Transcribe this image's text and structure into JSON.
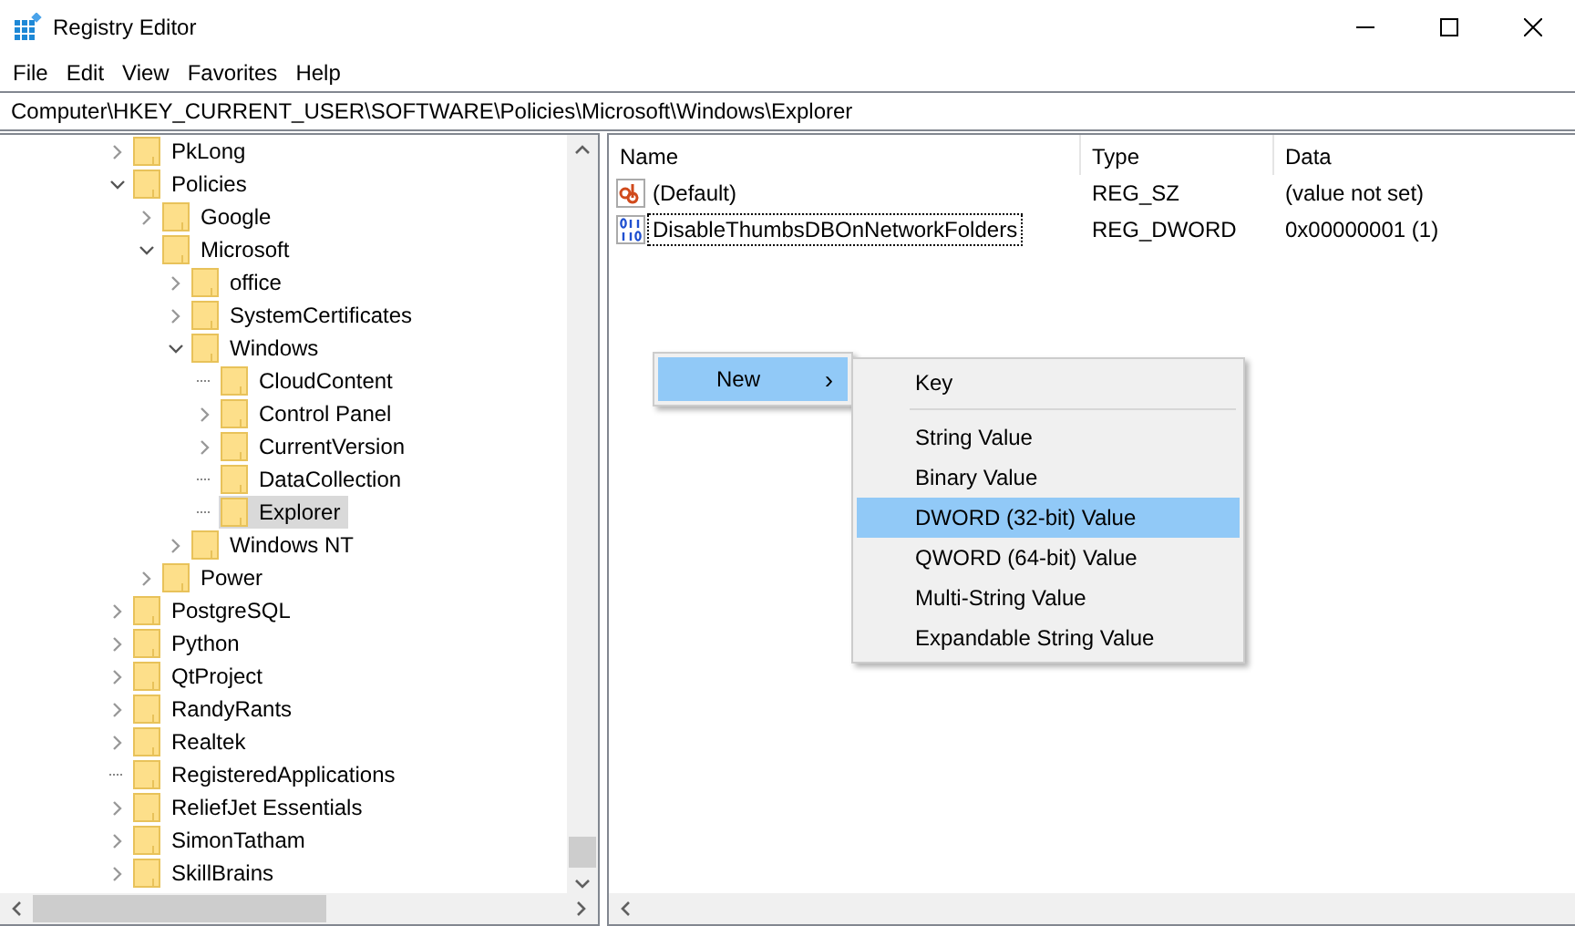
{
  "window": {
    "title": "Registry Editor"
  },
  "menu": [
    "File",
    "Edit",
    "View",
    "Favorites",
    "Help"
  ],
  "address": "Computer\\HKEY_CURRENT_USER\\SOFTWARE\\Policies\\Microsoft\\Windows\\Explorer",
  "tree": [
    {
      "label": "PkLong",
      "kind": "branch",
      "expanded": false,
      "selected": false
    },
    {
      "label": "Policies",
      "kind": "branch",
      "expanded": true,
      "selected": false,
      "children": [
        {
          "label": "Google",
          "kind": "branch",
          "expanded": false,
          "selected": false
        },
        {
          "label": "Microsoft",
          "kind": "branch",
          "expanded": true,
          "selected": false,
          "children": [
            {
              "label": "office",
              "kind": "branch",
              "expanded": false,
              "selected": false
            },
            {
              "label": "SystemCertificates",
              "kind": "branch",
              "expanded": false,
              "selected": false
            },
            {
              "label": "Windows",
              "kind": "branch",
              "expanded": true,
              "selected": false,
              "children": [
                {
                  "label": "CloudContent",
                  "kind": "leaf",
                  "selected": false
                },
                {
                  "label": "Control Panel",
                  "kind": "branch",
                  "expanded": false,
                  "selected": false
                },
                {
                  "label": "CurrentVersion",
                  "kind": "branch",
                  "expanded": false,
                  "selected": false
                },
                {
                  "label": "DataCollection",
                  "kind": "leaf",
                  "selected": false
                },
                {
                  "label": "Explorer",
                  "kind": "leaf",
                  "selected": true
                }
              ]
            },
            {
              "label": "Windows NT",
              "kind": "branch",
              "expanded": false,
              "selected": false
            }
          ]
        },
        {
          "label": "Power",
          "kind": "branch",
          "expanded": false,
          "selected": false
        }
      ]
    },
    {
      "label": "PostgreSQL",
      "kind": "branch",
      "expanded": false,
      "selected": false
    },
    {
      "label": "Python",
      "kind": "branch",
      "expanded": false,
      "selected": false
    },
    {
      "label": "QtProject",
      "kind": "branch",
      "expanded": false,
      "selected": false
    },
    {
      "label": "RandyRants",
      "kind": "branch",
      "expanded": false,
      "selected": false
    },
    {
      "label": "Realtek",
      "kind": "branch",
      "expanded": false,
      "selected": false
    },
    {
      "label": "RegisteredApplications",
      "kind": "leaf",
      "selected": false
    },
    {
      "label": "ReliefJet Essentials",
      "kind": "branch",
      "expanded": false,
      "selected": false
    },
    {
      "label": "SimonTatham",
      "kind": "branch",
      "expanded": false,
      "selected": false
    },
    {
      "label": "SkillBrains",
      "kind": "branch",
      "expanded": false,
      "selected": false
    }
  ],
  "values": {
    "columns": [
      "Name",
      "Type",
      "Data"
    ],
    "rows": [
      {
        "kind": "string",
        "name": "(Default)",
        "type": "REG_SZ",
        "data": "(value not set)",
        "focused": false
      },
      {
        "kind": "binary",
        "name": "DisableThumbsDBOnNetworkFolders",
        "type": "REG_DWORD",
        "data": "0x00000001 (1)",
        "focused": true
      }
    ]
  },
  "context_menu": {
    "label": "New",
    "arrow": "›",
    "selected": true
  },
  "submenu": [
    {
      "label": "Key",
      "selected": false
    },
    {
      "kind": "separator"
    },
    {
      "label": "String Value",
      "selected": false
    },
    {
      "label": "Binary Value",
      "selected": false
    },
    {
      "label": "DWORD (32-bit) Value",
      "selected": true
    },
    {
      "label": "QWORD (64-bit) Value",
      "selected": false
    },
    {
      "label": "Multi-String Value",
      "selected": false
    },
    {
      "label": "Expandable String Value",
      "selected": false
    }
  ]
}
